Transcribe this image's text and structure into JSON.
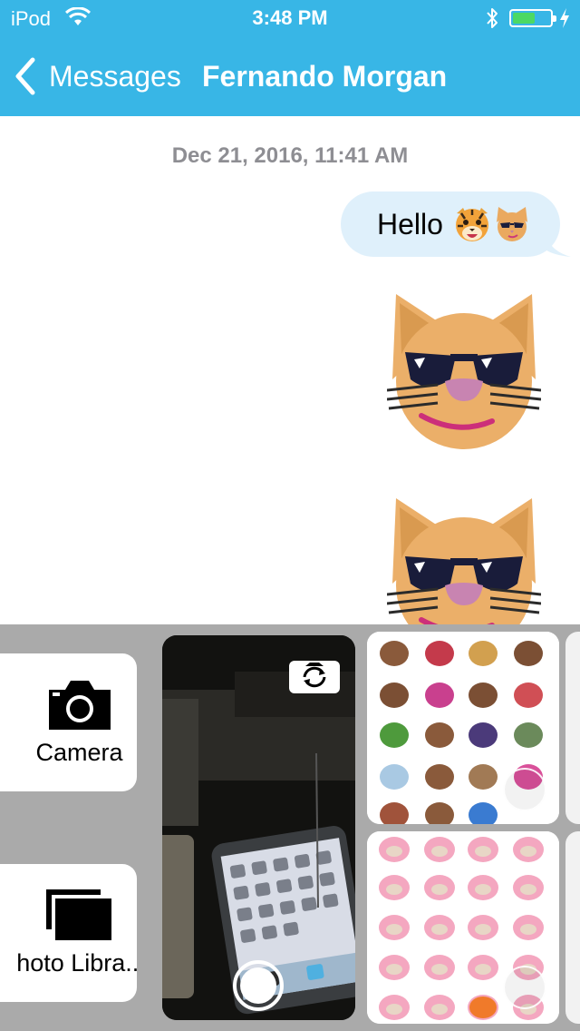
{
  "status_bar": {
    "carrier": "iPod",
    "time": "3:48 PM",
    "battery_level": 0.6
  },
  "nav": {
    "back_label": "Messages",
    "title": "Fernando Morgan"
  },
  "conversation": {
    "timestamp": "Dec 21, 2016, 11:41 AM",
    "messages": [
      {
        "type": "text",
        "text": "Hello",
        "emoji": [
          "tiger-face",
          "cat-with-sunglasses"
        ]
      },
      {
        "type": "sticker",
        "sticker": "cat-with-sunglasses"
      },
      {
        "type": "sticker",
        "sticker": "cat-with-sunglasses"
      }
    ]
  },
  "drawer": {
    "camera_label": "Camera",
    "library_label": "Photo Library",
    "library_label_visible": "hoto Libra..."
  },
  "colors": {
    "nav_bar": "#38b6e6",
    "outgoing_bubble": "#dff0fb",
    "drawer_background": "#aaaaaa",
    "timestamp_gray": "#8e8e93",
    "battery_green": "#4cd964"
  }
}
